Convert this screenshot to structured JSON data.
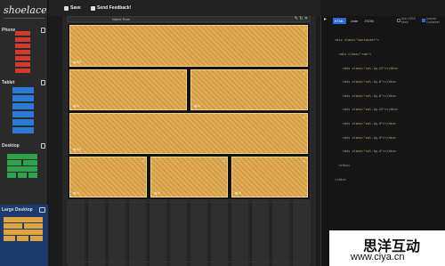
{
  "app": {
    "logo": "shoelace"
  },
  "sidebar": {
    "devices": [
      {
        "label": "Phone",
        "icon": "phone-icon"
      },
      {
        "label": "Tablet",
        "icon": "tablet-icon"
      },
      {
        "label": "Desktop",
        "icon": "monitor-icon"
      },
      {
        "label": "Large Desktop",
        "icon": "large-monitor-icon",
        "selected": true
      }
    ]
  },
  "toolbar": {
    "save_label": "Save",
    "feedback_label": "Send Feedback!"
  },
  "canvas": {
    "row_title": "Name Row",
    "rows": [
      {
        "cells": [
          {
            "label": "lg-12"
          }
        ]
      },
      {
        "cells": [
          {
            "label": "lg-6"
          },
          {
            "label": "lg-6"
          }
        ]
      },
      {
        "cells": [
          {
            "label": "lg-12"
          }
        ]
      },
      {
        "cells": [
          {
            "label": "lg-4"
          },
          {
            "label": "lg-4"
          },
          {
            "label": "lg-4"
          }
        ]
      }
    ]
  },
  "code_panel": {
    "tabs": [
      "HTML",
      "Jade",
      "JSON"
    ],
    "active_tab": "HTML",
    "options": [
      "Use LESS Mixin",
      "Include Container"
    ],
    "code_lines": [
      "<div class=\"container\">",
      "  <div class=\"row\">",
      "    <div class=\"col-lg-12\"></div>",
      "    <div class=\"col-lg-6\"></div>",
      "    <div class=\"col-lg-6\"></div>",
      "    <div class=\"col-lg-12\"></div>",
      "    <div class=\"col-lg-4\"></div>",
      "    <div class=\"col-lg-4\"></div>",
      "    <div class=\"col-lg-4\"></div>",
      "  </div>",
      "</div>"
    ]
  },
  "watermark": {
    "title": "思洋互动",
    "url": "www.ciya.cn"
  }
}
